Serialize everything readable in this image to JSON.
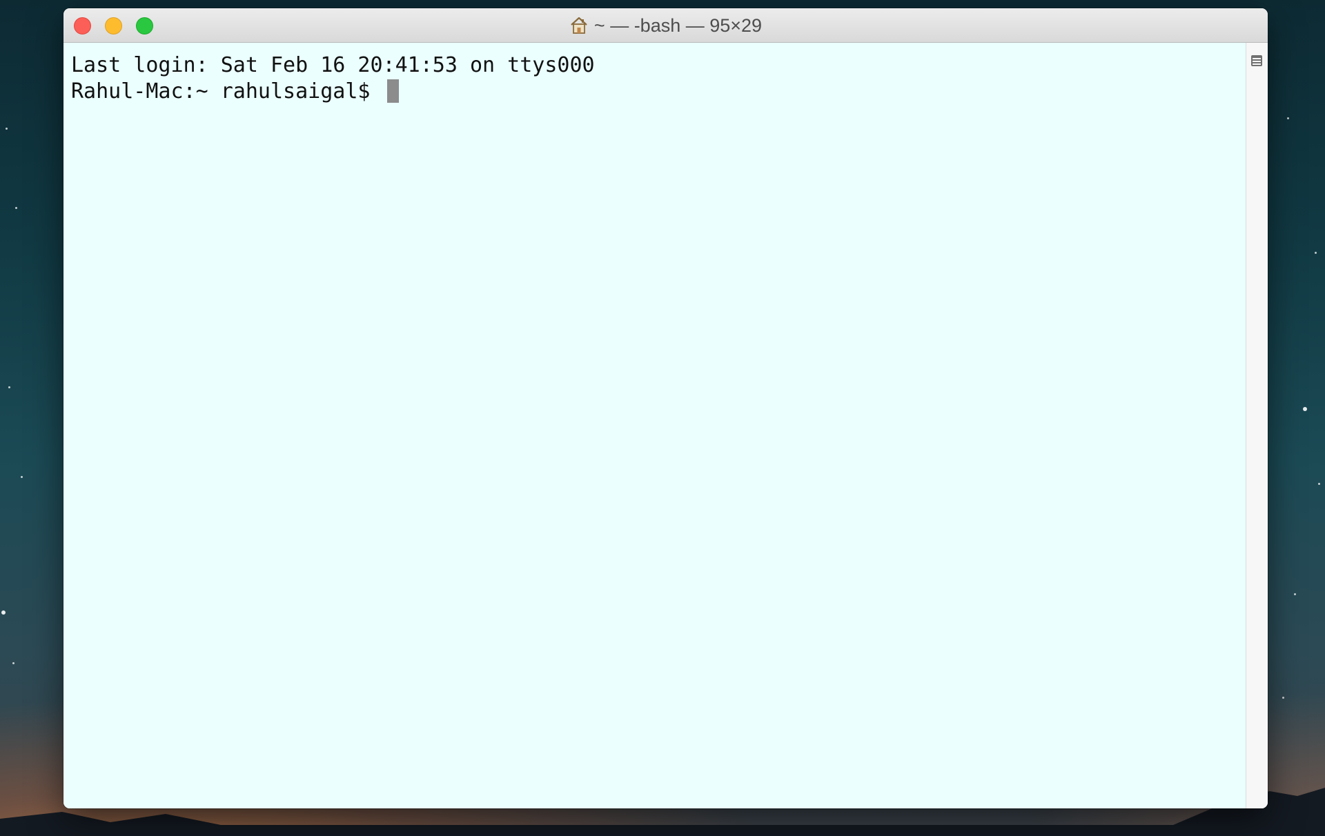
{
  "window": {
    "title": "~ — -bash — 95×29",
    "title_icon": "home-icon",
    "buttons": {
      "close": "close-button",
      "minimize": "minimize-button",
      "maximize": "maximize-button"
    }
  },
  "terminal": {
    "lines": [
      "Last login: Sat Feb 16 20:41:53 on ttys000",
      "Rahul-Mac:~ rahulsaigal$ "
    ],
    "background_color": "#ebfffe",
    "text_color": "#111111",
    "cursor_color": "#8c8c8c"
  },
  "scrollbar": {
    "icon": "split-pane-icon"
  }
}
